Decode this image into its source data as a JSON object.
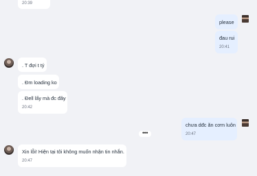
{
  "messages": [
    {
      "text": "",
      "time": "20:39"
    },
    {
      "text": "please",
      "time": ""
    },
    {
      "text": "đau rui",
      "time": "20:41"
    },
    {
      "text": ". T đợi t tý",
      "time": ""
    },
    {
      "text": ". Đm loading ko",
      "time": ""
    },
    {
      "text": ". Đell lấy mà đc đây",
      "time": "20:42"
    },
    {
      "text": "chưa dđc ăn cơm luôn",
      "time": "20:47"
    },
    {
      "text": "Xin lỗi! Hiện tại tôi không muốn nhận tin nhắn.",
      "time": "20:47"
    }
  ],
  "more_button": {
    "label": "•••"
  }
}
